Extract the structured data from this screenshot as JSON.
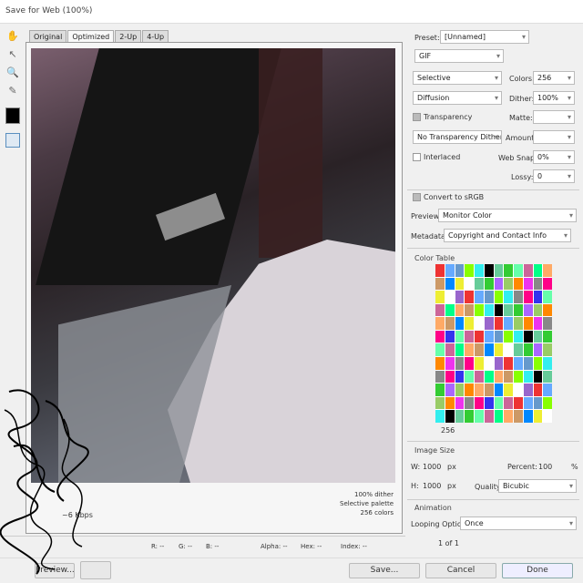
{
  "window": {
    "title": "Save for Web (100%)"
  },
  "tabs": [
    {
      "label": "Original"
    },
    {
      "label": "Optimized"
    },
    {
      "label": "2-Up"
    },
    {
      "label": "4-Up"
    }
  ],
  "image_info": {
    "size": "~6 Kbps",
    "dither": "100% dither",
    "palette": "Selective palette",
    "colors": "256 colors"
  },
  "readouts": {
    "r": "R: --",
    "g": "G: --",
    "b": "B: --",
    "alpha": "Alpha: --",
    "hex": "Hex: --",
    "index": "Index: --"
  },
  "buttons": {
    "preview": "Preview...",
    "save": "Save...",
    "cancel": "Cancel",
    "done": "Done"
  },
  "settings": {
    "preset_label": "Preset:",
    "preset_value": "[Unnamed]",
    "format": "GIF",
    "reduction": "Selective",
    "colors_label": "Colors:",
    "colors_value": "256",
    "dither_method": "Diffusion",
    "dither_label": "Dither:",
    "dither_value": "100%",
    "transparency_label": "Transparency",
    "matte_label": "Matte:",
    "transparency_dither": "No Transparency Dither",
    "amount_label": "Amount:",
    "interlaced_label": "Interlaced",
    "websnap_label": "Web Snap:",
    "websnap_value": "0%",
    "lossy_label": "Lossy:",
    "lossy_value": "0",
    "convert_label": "Convert to sRGB",
    "preview_label": "Preview:",
    "preview_value": "Monitor Color",
    "metadata_label": "Metadata:",
    "metadata_value": "Copyright and Contact Info"
  },
  "color_table": {
    "title": "Color Table",
    "count": "256"
  },
  "image_size": {
    "title": "Image Size",
    "w_label": "W:",
    "w_value": "1000",
    "h_label": "H:",
    "h_value": "1000",
    "unit": "px",
    "percent_label": "Percent:",
    "percent_value": "100",
    "percent_unit": "%",
    "quality_label": "Quality:",
    "quality_value": "Bicubic"
  },
  "animation": {
    "title": "Animation",
    "looping_label": "Looping Options:",
    "looping_value": "Once",
    "frame_counter": "1 of 1"
  },
  "icons": [
    "hand-icon",
    "slice-select-icon",
    "zoom-icon",
    "eyedropper-icon",
    "color-swatch",
    "toggle-slices-icon",
    "browser-preview-icon"
  ]
}
